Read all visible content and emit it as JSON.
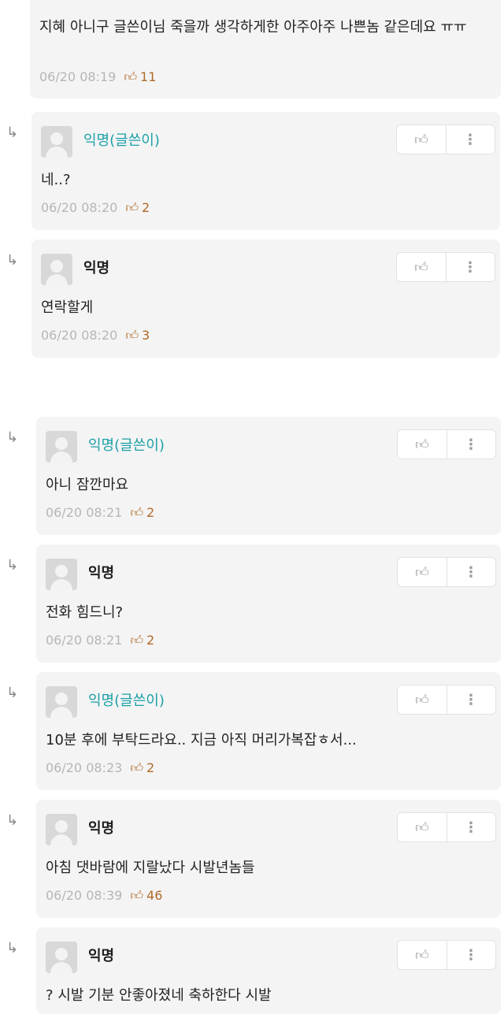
{
  "icons": {
    "reply": "reply-arrow-icon",
    "like": "thumbs-up-icon",
    "more": "more-vertical-icon"
  },
  "top": {
    "first": {
      "text": "지혜 아니구 글쓴이님 죽을까 생각하게한 아주아주 나쁜놈 같은데요 ㅠㅠ",
      "time": "06/20 08:19",
      "likes": "11"
    },
    "comments": [
      {
        "name": "익명(글쓴이)",
        "author": true,
        "text": "네..?",
        "time": "06/20 08:20",
        "likes": "2"
      },
      {
        "name": "익명",
        "author": false,
        "text": "연락할게",
        "time": "06/20 08:20",
        "likes": "3"
      }
    ]
  },
  "bottom": {
    "comments": [
      {
        "name": "익명(글쓴이)",
        "author": true,
        "text": "아니 잠깐마요",
        "time": "06/20 08:21",
        "likes": "2"
      },
      {
        "name": "익명",
        "author": false,
        "text": "전화 힘드니?",
        "time": "06/20 08:21",
        "likes": "2"
      },
      {
        "name": "익명(글쓴이)",
        "author": true,
        "text": "10분 후에 부탁드라요.. 지금 아직 머리가복잡ㅎ서...",
        "time": "06/20 08:23",
        "likes": "2"
      },
      {
        "name": "익명",
        "author": false,
        "text": "아침 댓바람에 지랄났다 시발년놈들",
        "time": "06/20 08:39",
        "likes": "46"
      },
      {
        "name": "익명",
        "author": false,
        "text": "? 시발 기분 안좋아졌네 축하한다 시발",
        "time": "",
        "likes": ""
      }
    ]
  }
}
